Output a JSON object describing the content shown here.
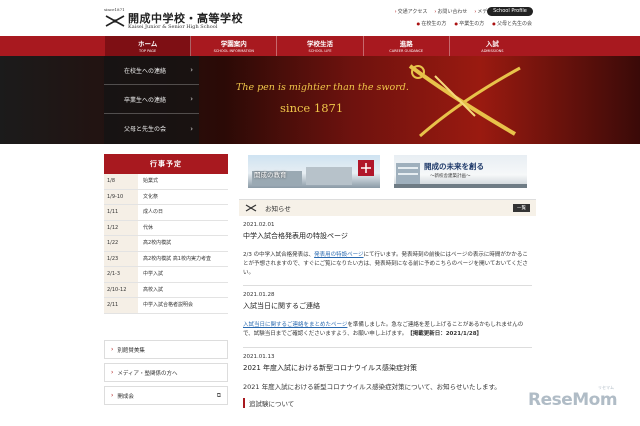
{
  "header": {
    "since_mark": "since1871",
    "school_name_jp": "開成中学校・高等学校",
    "school_name_en": "Kaisei Junior & Senior High School",
    "util_links": [
      "交通アクセス",
      "お問い合わせ",
      "メディア・塾関係の方へ"
    ],
    "util_links2": [
      "在校生の方",
      "卒業生の方",
      "父母と先生の会"
    ],
    "school_profile": "School Profile"
  },
  "nav": [
    {
      "jp": "ホーム",
      "en": "TOP PAGE",
      "active": true
    },
    {
      "jp": "学園案内",
      "en": "SCHOOL INFORMATION"
    },
    {
      "jp": "学校生活",
      "en": "SCHOOL LIFE"
    },
    {
      "jp": "進路",
      "en": "CAREER GUIDANCE"
    },
    {
      "jp": "入試",
      "en": "ADMISSIONS"
    }
  ],
  "hero": {
    "menu": [
      "在校生への連絡",
      "卒業生への連絡",
      "父母と先生の会"
    ],
    "motto": "The pen is mightier than the sword.",
    "since": "since 1871"
  },
  "schedule": {
    "title": "行事予定",
    "rows": [
      {
        "date": "1/8",
        "event": "始業式"
      },
      {
        "date": "1/9-10",
        "event": "文化祭"
      },
      {
        "date": "1/11",
        "event": "成人の日"
      },
      {
        "date": "1/12",
        "event": "代休"
      },
      {
        "date": "1/22",
        "event": "高2校内模試"
      },
      {
        "date": "1/23",
        "event": "高2校内模試 高1校内実力考査"
      },
      {
        "date": "2/1-3",
        "event": "中学入試"
      },
      {
        "date": "2/10-12",
        "event": "高校入試"
      },
      {
        "date": "2/11",
        "event": "中学入試合格者説明会"
      }
    ]
  },
  "side_links": [
    {
      "label": "別館賛美集",
      "external": false
    },
    {
      "label": "メディア・塾関係の方へ",
      "external": false
    },
    {
      "label": "開成会",
      "external": true
    }
  ],
  "banners": {
    "b1_title": "開成の教育",
    "b2_title": "開成の未来を創る",
    "b2_sub": "〜新校舎建築計画〜"
  },
  "news": {
    "header_title": "お知らせ",
    "list_button": "一覧",
    "items": [
      {
        "date": "2021.02.01",
        "title": "中学入試合格発表用の特設ページ",
        "body_pre": "2/3 の中学入試合格発表は、",
        "body_link": "発表用の特設ページ",
        "body_post": "にて行います。発表時刻の前後にはページの表示に時間がかかることが予想されますので、すぐにご覧になりたい方は、発表時刻になる前に予めこちらのページを開いておいてください。"
      },
      {
        "date": "2021.01.28",
        "title": "入試当日に関するご連絡",
        "body_link": "入試当日に関するご連絡をまとめたページ",
        "body_post": "を準備しました。急なご連絡を差し上げることがあるかもしれませんので、試験当日までご確認くださいますよう、お願い申し上げます。",
        "body_strong": "【掲載更新日：2021/1/28】"
      },
      {
        "date": "2021.01.13",
        "title": "2021 年度入試における新型コロナウイルス感染症対策",
        "body": "2021 年度入試における新型コロナウイルス感染症対策について、お知らせいたします。",
        "sub_heading": "追試験について"
      }
    ]
  },
  "watermark": {
    "text": "ReseMom",
    "sub": "リセマム"
  }
}
